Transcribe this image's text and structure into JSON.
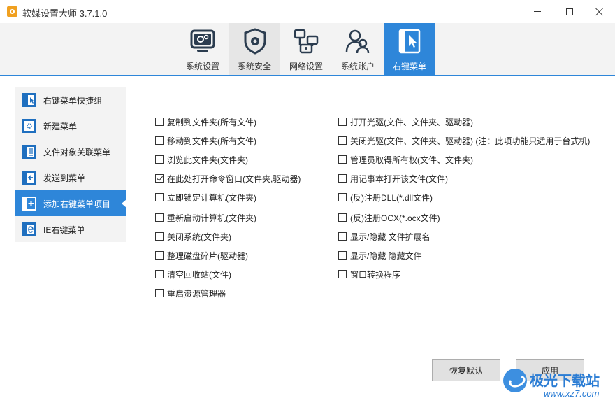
{
  "app": {
    "title": "软媒设置大师 3.7.1.0"
  },
  "colors": {
    "accent": "#2e86d9",
    "nav_bg": "#f3f3f3",
    "watermark": "#2a7cd4"
  },
  "nav_tabs": [
    {
      "label": "系统设置",
      "icon": "monitor-gear-icon",
      "state": "normal"
    },
    {
      "label": "系统安全",
      "icon": "shield-gear-icon",
      "state": "active"
    },
    {
      "label": "网络设置",
      "icon": "network-icon",
      "state": "normal"
    },
    {
      "label": "系统账户",
      "icon": "users-icon",
      "state": "normal"
    },
    {
      "label": "右键菜单",
      "icon": "cursor-window-icon",
      "state": "selected"
    }
  ],
  "sidebar": {
    "items": [
      {
        "label": "右键菜单快捷组",
        "icon": "quick-group-icon",
        "selected": false
      },
      {
        "label": "新建菜单",
        "icon": "new-menu-icon",
        "selected": false
      },
      {
        "label": "文件对象关联菜单",
        "icon": "list-menu-icon",
        "selected": false
      },
      {
        "label": "发送到菜单",
        "icon": "send-to-icon",
        "selected": false
      },
      {
        "label": "添加右键菜单项目",
        "icon": "add-item-icon",
        "selected": true
      },
      {
        "label": "IE右键菜单",
        "icon": "ie-icon",
        "selected": false
      }
    ]
  },
  "options": {
    "left": [
      {
        "label": "复制到文件夹(所有文件)",
        "checked": false
      },
      {
        "label": "移动到文件夹(所有文件)",
        "checked": false
      },
      {
        "label": "浏览此文件夹(文件夹)",
        "checked": false
      },
      {
        "label": "在此处打开命令窗口(文件夹,驱动器)",
        "checked": true
      },
      {
        "label": "立即锁定计算机(文件夹)",
        "checked": false
      },
      {
        "label": "重新启动计算机(文件夹)",
        "checked": false
      },
      {
        "label": "关闭系统(文件夹)",
        "checked": false
      },
      {
        "label": "整理磁盘碎片(驱动器)",
        "checked": false
      },
      {
        "label": "清空回收站(文件)",
        "checked": false
      },
      {
        "label": "重启资源管理器",
        "checked": false
      }
    ],
    "right": [
      {
        "label": "打开光驱(文件、文件夹、驱动器)",
        "checked": false
      },
      {
        "label": "关闭光驱(文件、文件夹、驱动器) (注：此项功能只适用于台式机)",
        "checked": false
      },
      {
        "label": "管理员取得所有权(文件、文件夹)",
        "checked": false
      },
      {
        "label": "用记事本打开该文件(文件)",
        "checked": false
      },
      {
        "label": "(反)注册DLL(*.dll文件)",
        "checked": false
      },
      {
        "label": "(反)注册OCX(*.ocx文件)",
        "checked": false
      },
      {
        "label": "显示/隐藏 文件扩展名",
        "checked": false
      },
      {
        "label": "显示/隐藏 隐藏文件",
        "checked": false
      },
      {
        "label": "窗口转换程序",
        "checked": false
      }
    ]
  },
  "buttons": {
    "restore_default": "恢复默认",
    "apply": "应用"
  },
  "watermark": {
    "name": "极光下载站",
    "url": "www.xz7.com"
  }
}
